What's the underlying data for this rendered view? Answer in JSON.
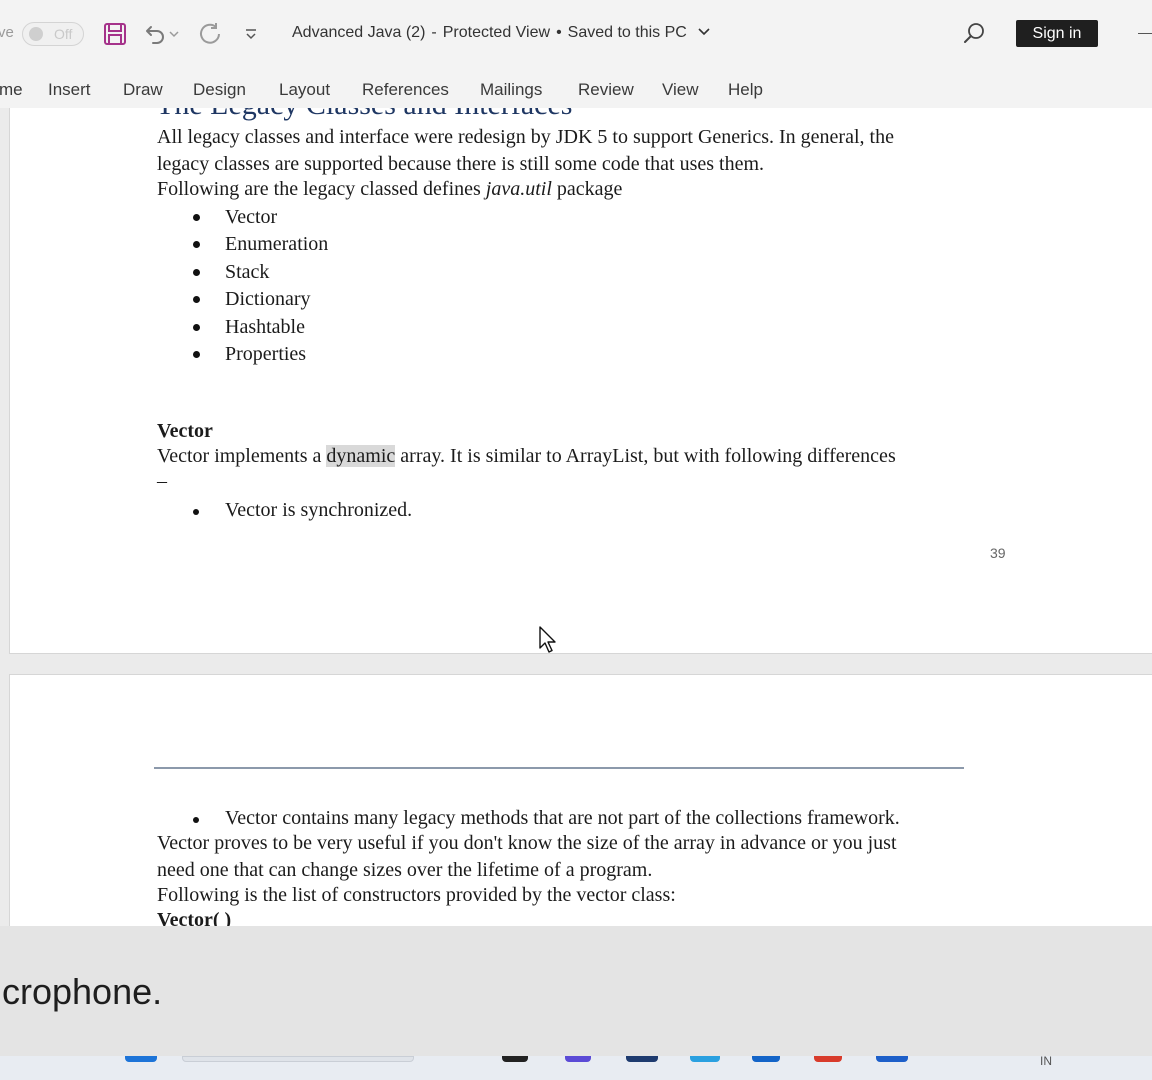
{
  "titlebar": {
    "autosave_label": "ve",
    "autosave_state": "Off",
    "document_name": "Advanced Java (2)",
    "separator": "-",
    "view_mode": "Protected View",
    "dot": "•",
    "save_status": "Saved to this PC",
    "sign_in": "Sign in"
  },
  "ribbon": {
    "tabs": [
      "me",
      "Insert",
      "Draw",
      "Design",
      "Layout",
      "References",
      "Mailings",
      "Review",
      "View",
      "Help"
    ]
  },
  "page1": {
    "heading": "The Legacy Classes and Interfaces",
    "intro_line1": "All legacy classes and interface were redesign by JDK 5 to support Generics. In general, the",
    "intro_line2": "legacy classes are supported because there is still some code that uses them.",
    "following_prefix": "Following are the legacy classed defines ",
    "following_italic": "java.util",
    "following_suffix": " package",
    "legacy_list": [
      "Vector",
      "Enumeration",
      "Stack",
      "Dictionary",
      "Hashtable",
      "Properties"
    ],
    "section_title": "Vector",
    "vector_prefix": "Vector implements a ",
    "vector_highlight": "dynamic",
    "vector_suffix": " array. It is similar to ArrayList, but with following differences",
    "dash": "–",
    "difference_1": "Vector is synchronized.",
    "page_number": "39"
  },
  "page2": {
    "difference_2": "Vector contains many legacy methods that are not part of the collections framework.",
    "para_line1": "Vector proves to be very useful if you don't know the size of the array in advance or you just",
    "para_line2": "need one that can change sizes over the lifetime of a program.",
    "constructors_line": "Following is the list of constructors provided by the vector class:",
    "constructor_cut": "Vector( )"
  },
  "caption": {
    "text": "icrophone."
  },
  "taskbar": {
    "language": "IN"
  },
  "colors": {
    "save_icon": "#a5328a",
    "heading": "#1f3763",
    "signin_bg": "#1f1f1f",
    "highlight": "#d9d9d9"
  },
  "icons": [
    "save-icon",
    "undo-icon",
    "redo-icon",
    "customize-qat-icon",
    "chevron-down-icon",
    "search-icon",
    "cursor-icon"
  ]
}
